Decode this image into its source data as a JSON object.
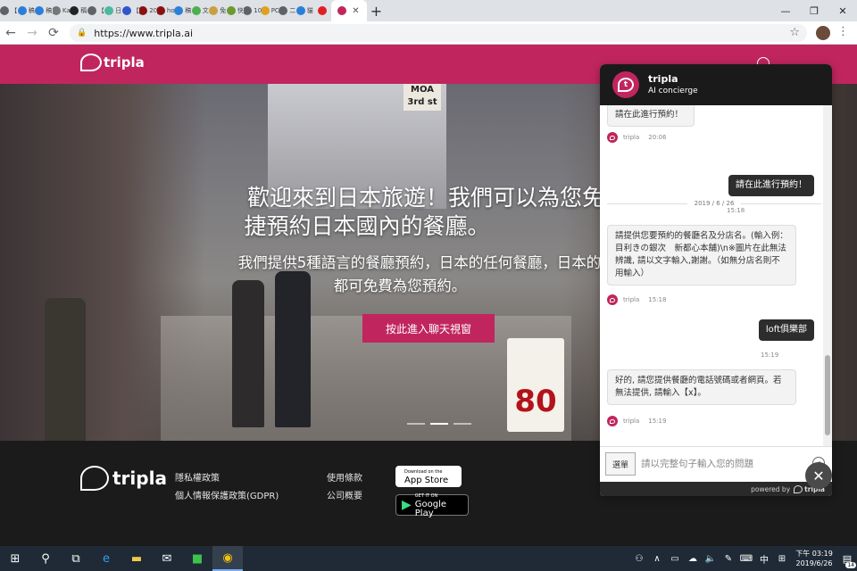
{
  "browser": {
    "tabs": [
      {
        "title": "【",
        "color": "#5f6368"
      },
      {
        "title": "稿",
        "color": "#2a80d8"
      },
      {
        "title": "稿",
        "color": "#2a80d8"
      },
      {
        "title": "Ka",
        "color": "#777777"
      },
      {
        "title": "稱",
        "color": "#222222"
      },
      {
        "title": "【",
        "color": "#5f6368"
      },
      {
        "title": "日",
        "color": "#4cb8a0"
      },
      {
        "title": "【",
        "color": "#3355cc"
      },
      {
        "title": "20",
        "color": "#8b1010"
      },
      {
        "title": "ho",
        "color": "#8b1010"
      },
      {
        "title": "稿",
        "color": "#2a80d8"
      },
      {
        "title": "文",
        "color": "#4caf50"
      },
      {
        "title": "免",
        "color": "#c9a040"
      },
      {
        "title": "快",
        "color": "#6a9a30"
      },
      {
        "title": "10",
        "color": "#5f6368"
      },
      {
        "title": "PC",
        "color": "#e0a020"
      },
      {
        "title": "二",
        "color": "#5f6368"
      },
      {
        "title": "貓",
        "color": "#2a80d8"
      },
      {
        "title": "",
        "color": "#e02020"
      },
      {
        "title": "",
        "color": "#c0265d",
        "active": true
      }
    ],
    "new_tab": "+",
    "window_controls": {
      "minimize": "—",
      "maximize": "❐",
      "close": "✕"
    },
    "url": "https://www.tripla.ai",
    "back": "←",
    "forward": "→",
    "reload": "⟳",
    "star": "☆",
    "menu": "⋮"
  },
  "site": {
    "brand": "tripla",
    "hero": {
      "title_line1": "歡迎來到日本旅遊！我們可以為您免",
      "title_line2": "捷預約日本國內的餐廳。",
      "subtitle_line1": "我們提供5種語言的餐廳預約，日本的任何餐廳，日本的",
      "subtitle_line2": "都可免費為您預約。",
      "button": "按此進入聊天視窗",
      "sign_number": "80",
      "sign_moa": "MOA 3rd st"
    },
    "footer": {
      "links": [
        "隱私權政策",
        "個人情報保護政策(GDPR)",
        "使用條款",
        "公司概要"
      ],
      "app_store": {
        "small": "Download on the",
        "big": "App Store"
      },
      "google_play": {
        "small": "GET IT ON",
        "big": "Google Play"
      }
    }
  },
  "chat": {
    "name": "tripla",
    "role": "AI concierge",
    "avatar_letter": "t",
    "messages": [
      {
        "side": "left",
        "text": "請在此進行預約！",
        "sender": "tripla",
        "time": "20:06"
      },
      {
        "side": "sep",
        "text": "2019 / 6 / 26"
      },
      {
        "side": "right",
        "text": "請在此進行預約！",
        "time": "15:18"
      },
      {
        "side": "left",
        "text": "請提供您要預約的餐廳名及分店名。(輸入例：目利きの銀次　新都心本舗)\\n※圖片在此無法辨識, 請以文字輸入,謝謝。（如無分店名則不用輸入）",
        "sender": "tripla",
        "time": "15:18"
      },
      {
        "side": "right",
        "text": "loft俱樂部",
        "time": "15:19"
      },
      {
        "side": "left",
        "text": "好的, 請您提供餐廳的電話號碼或者網頁。若無法提供, 請輸入【x】。",
        "sender": "tripla",
        "time": "15:19"
      }
    ],
    "menu_button": "選單",
    "input_placeholder": "請以完整句子輸入您的問題",
    "powered_by": "powered by",
    "powered_brand": "tripla",
    "close": "✕"
  },
  "taskbar": {
    "clock_time": "下午 03:19",
    "clock_date": "2019/6/26",
    "ime": "中",
    "notifications": "14"
  },
  "colors": {
    "brand": "#c0265d",
    "footer": "#1b1b1b",
    "chat_header": "#1a1a1a"
  }
}
